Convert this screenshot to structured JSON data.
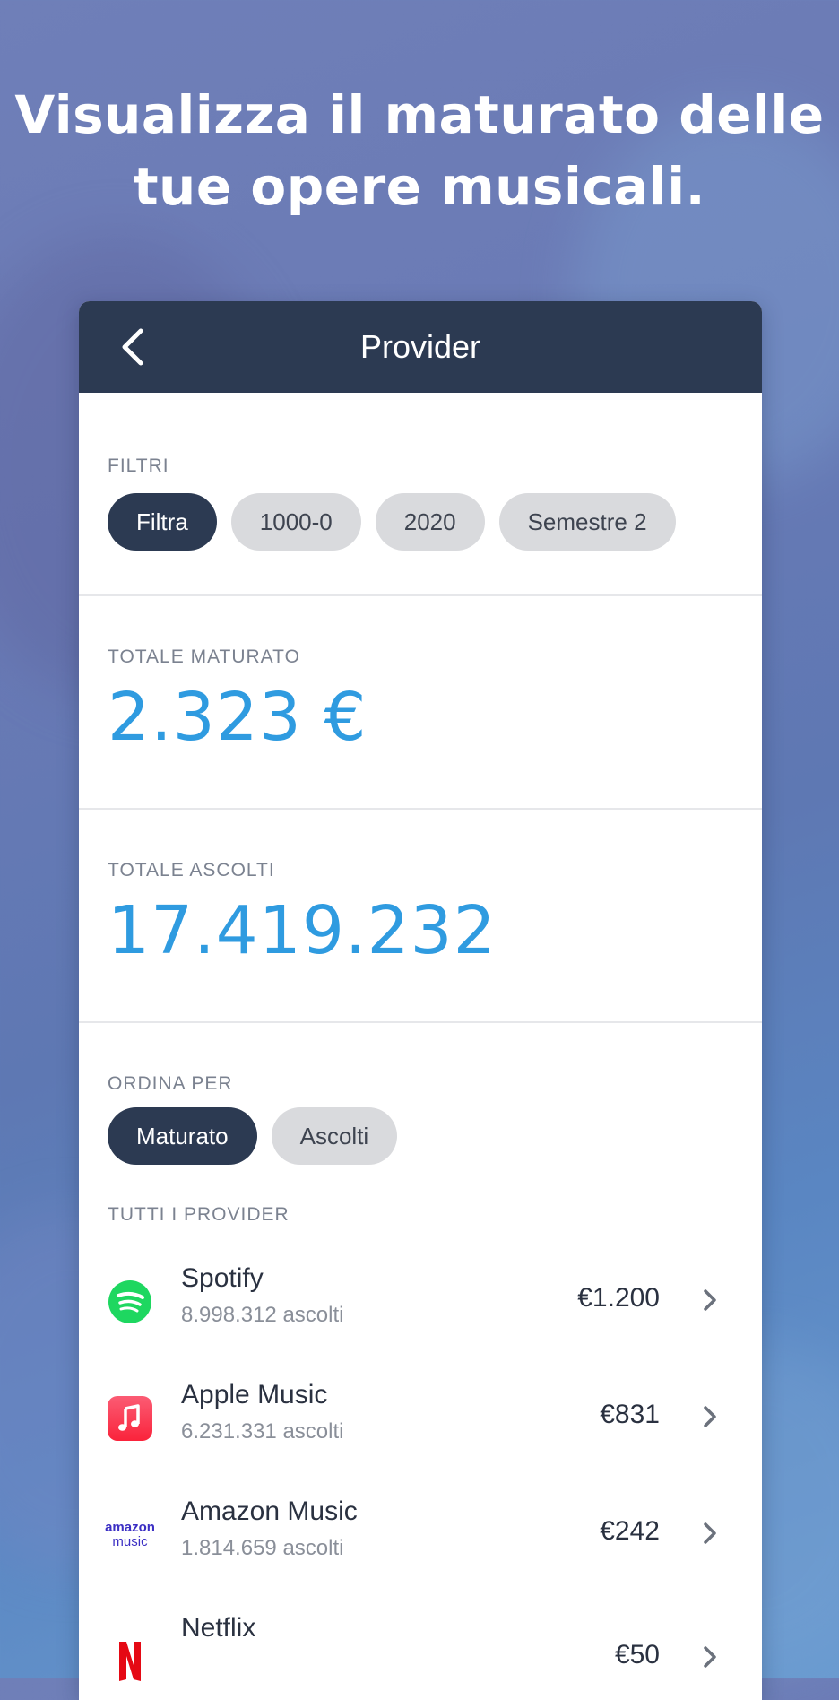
{
  "headline": {
    "line1": "Visualizza il maturato delle",
    "line2": "tue opere musicali."
  },
  "navbar": {
    "title": "Provider",
    "back_icon": "chevron-left-icon"
  },
  "filters": {
    "label": "FILTRI",
    "chips": [
      {
        "label": "Filtra",
        "active": true
      },
      {
        "label": "1000-0",
        "active": false
      },
      {
        "label": "2020",
        "active": false
      },
      {
        "label": "Semestre 2",
        "active": false
      }
    ]
  },
  "totale_maturato": {
    "label": "TOTALE MATURATO",
    "value": "2.323 €"
  },
  "totale_ascolti": {
    "label": "TOTALE ASCOLTI",
    "value": "17.419.232"
  },
  "ordina": {
    "label": "ORDINA PER",
    "chips": [
      {
        "label": "Maturato",
        "active": true
      },
      {
        "label": "Ascolti",
        "active": false
      }
    ]
  },
  "providers": {
    "label": "TUTTI I PROVIDER",
    "items": [
      {
        "name": "Spotify",
        "sub": "8.998.312 ascolti",
        "amount": "€1.200",
        "icon": "spotify-icon"
      },
      {
        "name": "Apple Music",
        "sub": "6.231.331 ascolti",
        "amount": "€831",
        "icon": "apple-music-icon"
      },
      {
        "name": "Amazon Music",
        "sub": "1.814.659 ascolti",
        "amount": "€242",
        "icon": "amazon-music-icon",
        "logo_text_1": "amazon",
        "logo_text_2": "music"
      },
      {
        "name": "Netflix",
        "sub": "",
        "amount": "€50",
        "icon": "netflix-icon"
      }
    ]
  },
  "colors": {
    "navbar": "#2c3a52",
    "accent": "#2f9be0",
    "spotify": "#1ed760",
    "apple_music": "#fa2d48",
    "amazon": "#3b2fc4",
    "netflix": "#e50914"
  }
}
